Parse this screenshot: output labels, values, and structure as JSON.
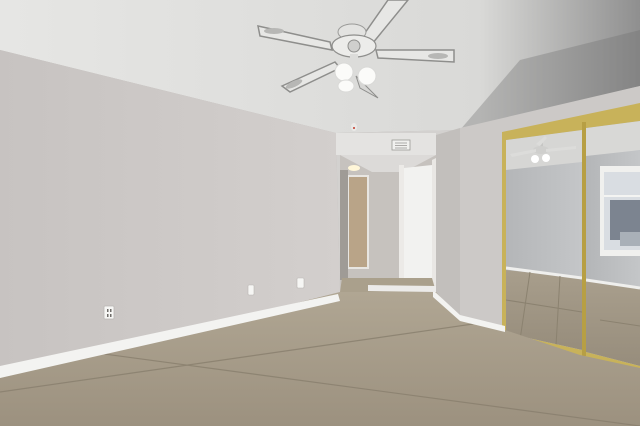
{
  "scene": {
    "kind": "empty-bedroom-interior-photo",
    "colors": {
      "ceiling": "#e2e2e0",
      "ceiling_shadow": "#a8a8a8",
      "wall_left": "#cfcbc9",
      "wall_right": "#c9c6c4",
      "wall_back": "#d6d4d2",
      "hall_wall": "#c4c1bd",
      "baseboard": "#f4f4f2",
      "floor_base": "#a39886",
      "floor_tile_light": "#b3a896",
      "grout": "#8e8474",
      "door_white": "#f2f2f0",
      "door_wood": "#b9a488",
      "mirror_frame": "#c8b25a",
      "mirror_glass": "#b9bbbd"
    },
    "icons": [
      "ceiling-fan-icon",
      "outlet-icon",
      "light-switch-icon",
      "air-vent-icon",
      "smoke-detector-icon"
    ]
  }
}
